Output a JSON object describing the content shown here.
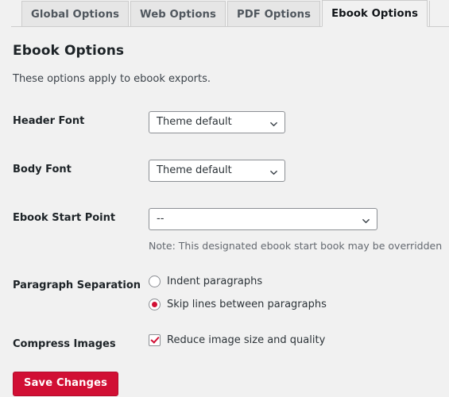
{
  "tabs": [
    {
      "label": "Global Options",
      "active": false
    },
    {
      "label": "Web Options",
      "active": false
    },
    {
      "label": "PDF Options",
      "active": false
    },
    {
      "label": "Ebook Options",
      "active": true
    }
  ],
  "page": {
    "title": "Ebook Options",
    "description": "These options apply to ebook exports."
  },
  "fields": {
    "header_font": {
      "label": "Header Font",
      "value": "Theme default"
    },
    "body_font": {
      "label": "Body Font",
      "value": "Theme default"
    },
    "start_point": {
      "label": "Ebook Start Point",
      "value": "--",
      "note": "Note: This designated ebook start book may be overridden"
    },
    "paragraph_separation": {
      "label": "Paragraph Separation",
      "options": [
        {
          "label": "Indent paragraphs",
          "selected": false
        },
        {
          "label": "Skip lines between paragraphs",
          "selected": true
        }
      ]
    },
    "compress_images": {
      "label": "Compress Images",
      "option_label": "Reduce image size and quality",
      "checked": true
    }
  },
  "actions": {
    "save_label": "Save Changes"
  },
  "colors": {
    "accent": "#d10f34",
    "page_background": "#f1f1f1",
    "tab_inactive": "#e6e6e6",
    "border": "#cccccc",
    "note_text": "#646970"
  }
}
